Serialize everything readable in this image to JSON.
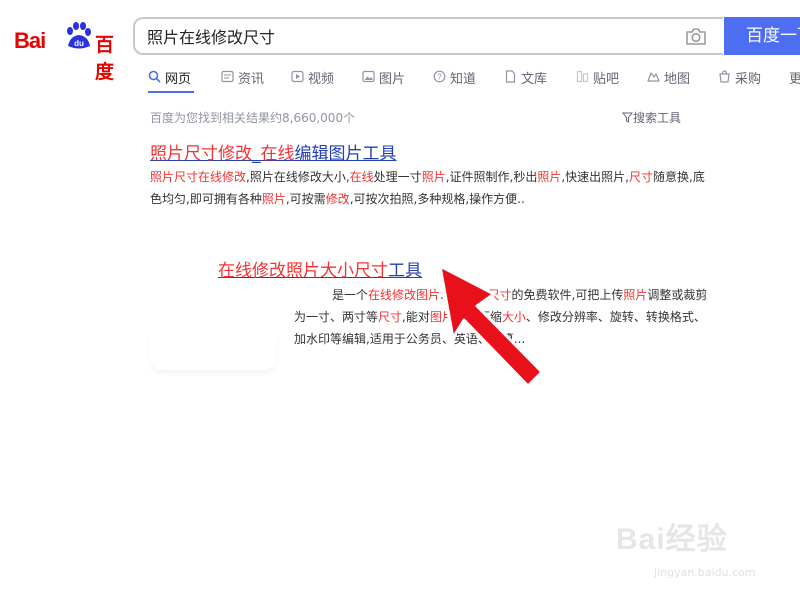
{
  "logo": {
    "left_text": "Bai",
    "right_text": "百度",
    "paw_text": "du"
  },
  "search": {
    "query": "照片在线修改尺寸",
    "button_label": "百度一下"
  },
  "tabs": [
    {
      "label": "网页",
      "icon": "search-icon"
    },
    {
      "label": "资讯",
      "icon": "news-icon"
    },
    {
      "label": "视频",
      "icon": "video-icon"
    },
    {
      "label": "图片",
      "icon": "image-icon"
    },
    {
      "label": "知道",
      "icon": "question-icon"
    },
    {
      "label": "文库",
      "icon": "doc-icon"
    },
    {
      "label": "贴吧",
      "icon": "tieba-icon"
    },
    {
      "label": "地图",
      "icon": "map-icon"
    },
    {
      "label": "采购",
      "icon": "shop-icon"
    },
    {
      "label": "更",
      "icon": ""
    }
  ],
  "meta": {
    "result_count": "百度为您找到相关结果约8,660,000个",
    "search_tools": "搜索工具"
  },
  "results": [
    {
      "title_parts": [
        {
          "text": "照片尺寸修改",
          "em": true
        },
        {
          "text": "_",
          "em": false
        },
        {
          "text": "在线",
          "em": true
        },
        {
          "text": "编辑图片工具",
          "em": false
        }
      ],
      "abstract_parts": [
        {
          "text": "照片尺寸在线修改",
          "em": true
        },
        {
          "text": ",照片在线修改大小,",
          "em": false
        },
        {
          "text": "在线",
          "em": true
        },
        {
          "text": "处理一寸",
          "em": false
        },
        {
          "text": "照片",
          "em": true
        },
        {
          "text": ",证件照制作,秒出",
          "em": false
        },
        {
          "text": "照片",
          "em": true
        },
        {
          "text": ",快速出照片,",
          "em": false
        },
        {
          "text": "尺寸",
          "em": true
        },
        {
          "text": "随意换,底色均匀,即可拥有各种",
          "em": false
        },
        {
          "text": "照片",
          "em": true
        },
        {
          "text": ",可按需",
          "em": false
        },
        {
          "text": "修改",
          "em": true
        },
        {
          "text": ",可按次拍照,多种规格,操作方便..",
          "em": false
        }
      ]
    },
    {
      "title_parts": [
        {
          "text": "在线修改照片大小尺寸",
          "em": true
        },
        {
          "text": "工具",
          "em": false
        }
      ],
      "abstract_parts": [
        {
          "text": "是一个",
          "em": false
        },
        {
          "text": "在线修改图片",
          "em": true
        },
        {
          "text": "...",
          "em": false
        },
        {
          "text": "大小",
          "em": true
        },
        {
          "text": "和",
          "em": false
        },
        {
          "text": "尺寸",
          "em": true
        },
        {
          "text": "的免费软件,可把上传",
          "em": false
        },
        {
          "text": "照片",
          "em": true
        },
        {
          "text": "调整或裁剪为一寸、两寸等",
          "em": false
        },
        {
          "text": "尺寸",
          "em": true
        },
        {
          "text": ",能对",
          "em": false
        },
        {
          "text": "图片",
          "em": true
        },
        {
          "text": "进行压缩",
          "em": false
        },
        {
          "text": "大小",
          "em": true
        },
        {
          "text": "、修改分辨率、旋转、转换格式、加水印等编辑,适用于公务员、英语、计算...",
          "em": false
        }
      ]
    }
  ],
  "watermark": {
    "brand": "Bai经验",
    "url": "jingyan.baidu.com"
  },
  "colors": {
    "brand_red": "#e10602",
    "accent_blue": "#4e6ef2",
    "link_blue": "#2440b3",
    "highlight_red": "#f73131",
    "arrow_red": "#e8101b"
  }
}
